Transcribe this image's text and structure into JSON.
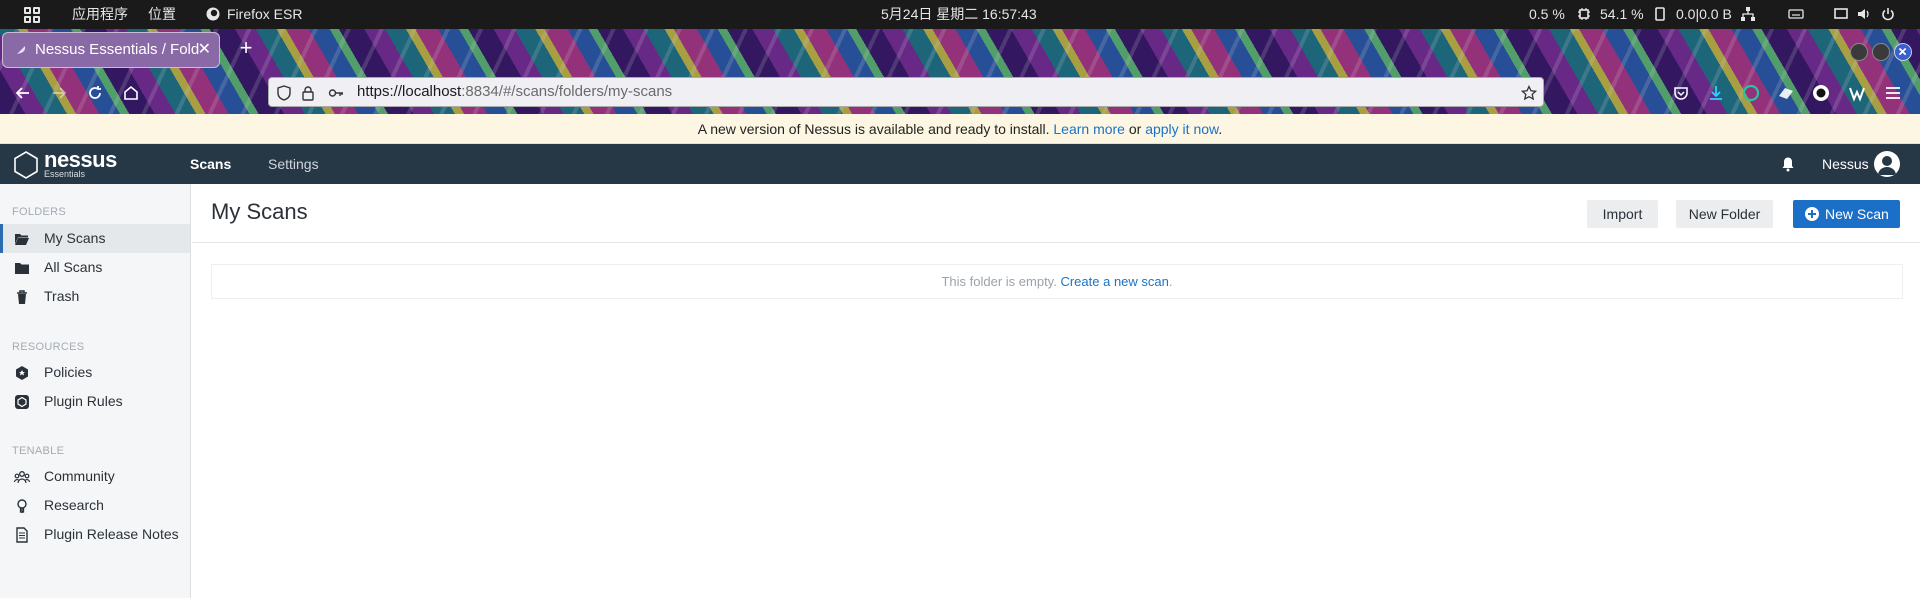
{
  "system_bar": {
    "apps_label": "应用程序",
    "places_label": "位置",
    "browser_label": "Firefox ESR",
    "datetime": "5月24日 星期二 16:57:43",
    "cpu": "0.5 %",
    "memory": "54.1 %",
    "network": "0.0|0.0 B"
  },
  "browser": {
    "tab_title": "Nessus Essentials / Folders",
    "url_host": "https://localhost",
    "url_rest": ":8834/#/scans/folders/my-scans"
  },
  "banner": {
    "text": "A new version of Nessus is available and ready to install.",
    "learn_more": "Learn more",
    "or": "or",
    "apply_now": "apply it now",
    "period": "."
  },
  "header": {
    "logo_word": "nessus",
    "logo_sub": "Essentials",
    "nav_scans": "Scans",
    "nav_settings": "Settings",
    "user": "Nessus"
  },
  "sidebar": {
    "folders_heading": "FOLDERS",
    "my_scans": "My Scans",
    "all_scans": "All Scans",
    "trash": "Trash",
    "resources_heading": "RESOURCES",
    "policies": "Policies",
    "plugin_rules": "Plugin Rules",
    "tenable_heading": "TENABLE",
    "community": "Community",
    "research": "Research",
    "plugin_release_notes": "Plugin Release Notes"
  },
  "main": {
    "title": "My Scans",
    "import": "Import",
    "new_folder": "New Folder",
    "new_scan": "New Scan",
    "empty_text": "This folder is empty.",
    "create_link": "Create a new scan",
    "create_period": "."
  },
  "colors": {
    "header_bg": "#263746",
    "accent_blue": "#1c6fc7",
    "link": "#1a73c9",
    "banner_bg": "#fdf6e3"
  }
}
